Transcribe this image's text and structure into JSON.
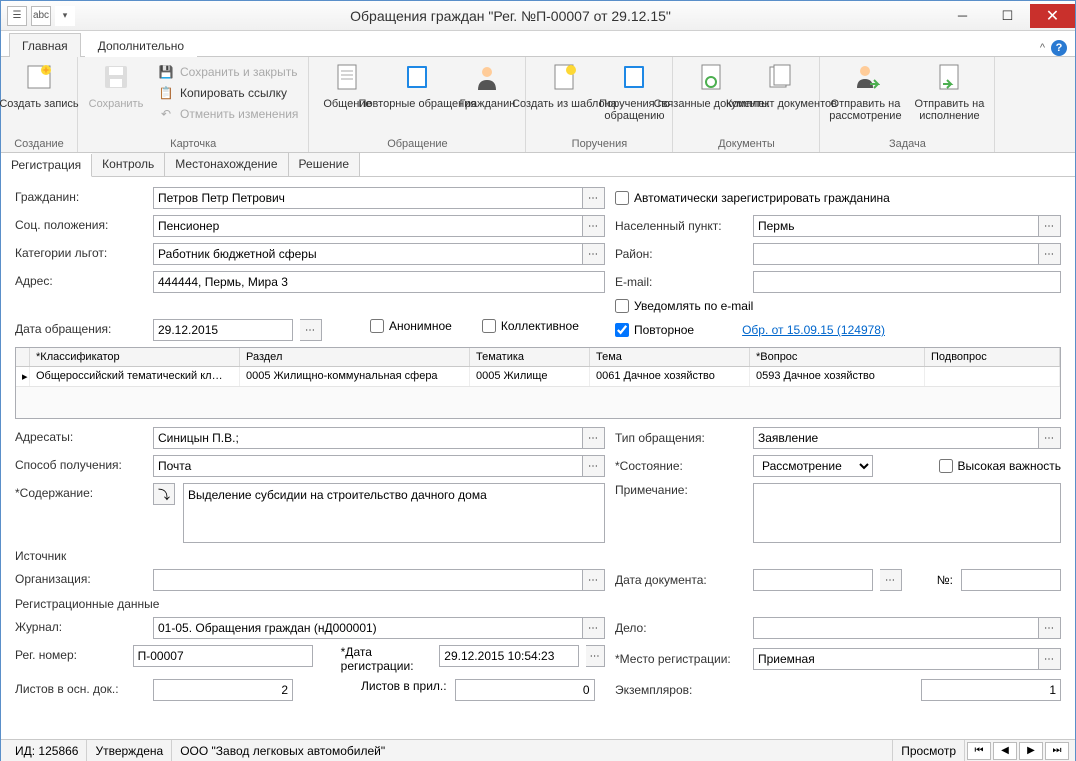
{
  "title": "Обращения граждан \"Рег. №П-00007 от 29.12.15\"",
  "ribbon_tabs": {
    "main": "Главная",
    "extra": "Дополнительно"
  },
  "ribbon": {
    "create": {
      "big": "Создать запись",
      "group": "Создание"
    },
    "card": {
      "save": "Сохранить",
      "saveclose": "Сохранить и закрыть",
      "copy": "Копировать ссылку",
      "undo": "Отменить изменения",
      "group": "Карточка"
    },
    "appeal": {
      "general": "Общение",
      "repeat": "Повторные обращения",
      "citizen": "Гражданин",
      "group": "Обращение"
    },
    "orders": {
      "tpl": "Создать из шаблона",
      "by": "Поручения по обращению",
      "group": "Поручения"
    },
    "docs": {
      "linked": "Связанные документы",
      "set": "Комплект документов",
      "group": "Документы"
    },
    "task": {
      "review": "Отправить на рассмотрение",
      "exec": "Отправить на исполнение",
      "group": "Задача"
    }
  },
  "subtabs": {
    "reg": "Регистрация",
    "ctrl": "Контроль",
    "loc": "Местонахождение",
    "dec": "Решение"
  },
  "labels": {
    "citizen": "Гражданин:",
    "social": "Соц. положения:",
    "benefit": "Категории льгот:",
    "address": "Адрес:",
    "date": "Дата обращения:",
    "anon": "Анонимное",
    "collective": "Коллективное",
    "repeat": "Повторное",
    "autoreg": "Автоматически зарегистрировать гражданина",
    "city": "Населенный пункт:",
    "district": "Район:",
    "email": "E-mail:",
    "notify": "Уведомлять по e-mail",
    "link": "Обр.  от 15.09.15 (124978)",
    "addressees": "Адресаты:",
    "type": "Тип обращения:",
    "method": "Способ получения:",
    "state": "*Состояние:",
    "important": "Высокая важность",
    "content": "*Содержание:",
    "note": "Примечание:",
    "source": "Источник",
    "org": "Организация:",
    "docdate": "Дата документа:",
    "num": "№:",
    "regdata": "Регистрационные данные",
    "journal": "Журнал:",
    "case": "Дело:",
    "regnum": "Рег. номер:",
    "regdate": "*Дата регистрации:",
    "regplace": "*Место регистрации:",
    "sheets_main": "Листов в осн. док.:",
    "sheets_att": "Листов в прил.:",
    "copies": "Экземпляров:"
  },
  "grid": {
    "h1": "*Классификатор",
    "h2": "Раздел",
    "h3": "Тематика",
    "h4": "Тема",
    "h5": "*Вопрос",
    "h6": "Подвопрос",
    "c1": "Общероссийский тематический кл…",
    "c2": "0005 Жилищно-коммунальная сфера",
    "c3": "0005 Жилище",
    "c4": "0061 Дачное хозяйство",
    "c5": "0593 Дачное хозяйство",
    "c6": ""
  },
  "values": {
    "citizen": "Петров Петр Петрович",
    "social": "Пенсионер",
    "benefit": "Работник бюджетной сферы",
    "address": "444444, Пермь, Мира 3",
    "date": "29.12.2015",
    "city": "Пермь",
    "addressees": "Синицын П.В.;",
    "type": "Заявление",
    "method": "Почта",
    "state": "Рассмотрение",
    "content": "Выделение субсидии на строительство дачного дома",
    "journal": "01-05. Обращения граждан (нД000001)",
    "regnum": "П-00007",
    "regdate": "29.12.2015 10:54:23",
    "regplace": "Приемная",
    "sheets_main": "2",
    "sheets_att": "0",
    "copies": "1"
  },
  "status": {
    "id": "ИД: 125866",
    "state": "Утверждена",
    "org": "ООО \"Завод легковых автомобилей\"",
    "mode": "Просмотр"
  }
}
